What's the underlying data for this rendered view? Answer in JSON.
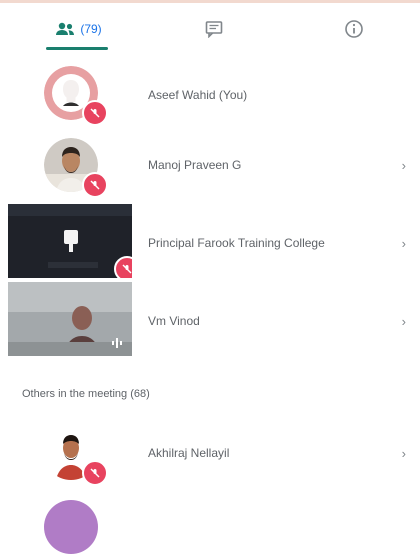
{
  "tabs": {
    "people_count": "(79)",
    "active": "people"
  },
  "participants": [
    {
      "name": "Aseef Wahid (You)",
      "muted": true,
      "avatar": "person-silhouette-icon"
    },
    {
      "name": "Manoj Praveen G",
      "muted": true,
      "avatar": "photo"
    },
    {
      "name": "Principal Farook Training College",
      "muted": true,
      "avatar": "video-tile"
    },
    {
      "name": "Vm Vinod",
      "muted": false,
      "avatar": "video-tile"
    }
  ],
  "others": {
    "header": "Others in the meeting (68)",
    "items": [
      {
        "name": "Akhilraj Nellayil",
        "muted": true
      }
    ]
  },
  "colors": {
    "accent": "#1a73e8",
    "tab_underline": "#1a7f6e",
    "mic_off": "#e8435f"
  }
}
